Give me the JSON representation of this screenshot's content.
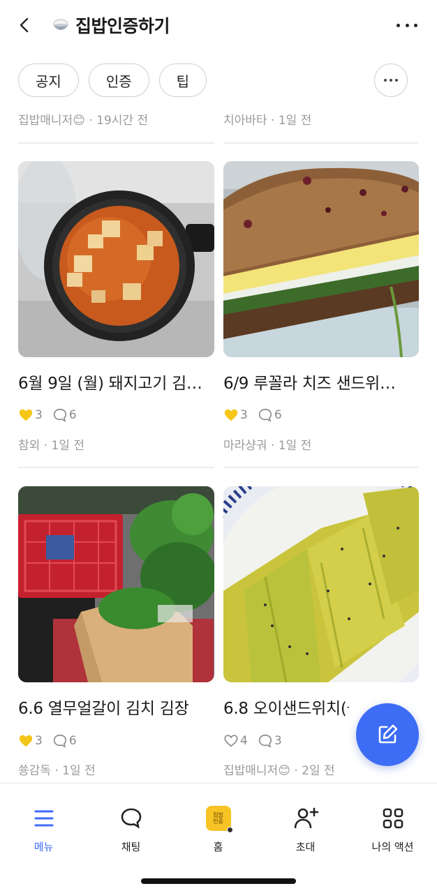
{
  "header": {
    "title": "집밥인증하기"
  },
  "filters": [
    "공지",
    "인증",
    "팁"
  ],
  "top_meta": [
    {
      "author": "집밥매니저",
      "emoji": "😊",
      "time": "19시간 전"
    },
    {
      "author": "치아바타",
      "emoji": "",
      "time": "1일 전"
    }
  ],
  "posts": [
    {
      "title": "6월 9일 (월) 돼지고기 김…",
      "likes": "3",
      "liked": true,
      "comments": "6",
      "author": "참외",
      "emoji": "",
      "time": "1일 전"
    },
    {
      "title": "6/9 루꼴라 치즈 샌드위…",
      "likes": "3",
      "liked": true,
      "comments": "6",
      "author": "마라샹궈",
      "emoji": "",
      "time": "1일 전"
    },
    {
      "title": "6.6 열무얼갈이 김치 김장",
      "likes": "3",
      "liked": true,
      "comments": "6",
      "author": "쑝감독",
      "emoji": "",
      "time": "1일 전"
    },
    {
      "title": "6.8 오이샌드위치(블랙…",
      "likes": "4",
      "liked": false,
      "comments": "3",
      "author": "집밥매니저",
      "emoji": "😊",
      "time": "2일 전"
    }
  ],
  "bottom_nav": [
    {
      "label": "메뉴",
      "icon": "menu-icon",
      "active": true
    },
    {
      "label": "채팅",
      "icon": "chat-icon",
      "active": false
    },
    {
      "label": "홈",
      "icon": "home-icon",
      "active": false
    },
    {
      "label": "초대",
      "icon": "invite-icon",
      "active": false
    },
    {
      "label": "나의 액션",
      "icon": "grid-icon",
      "active": false
    }
  ],
  "colors": {
    "accent": "#3d6cf5",
    "like_heart": "#f5c518",
    "meta_text": "#9a9a9a"
  }
}
